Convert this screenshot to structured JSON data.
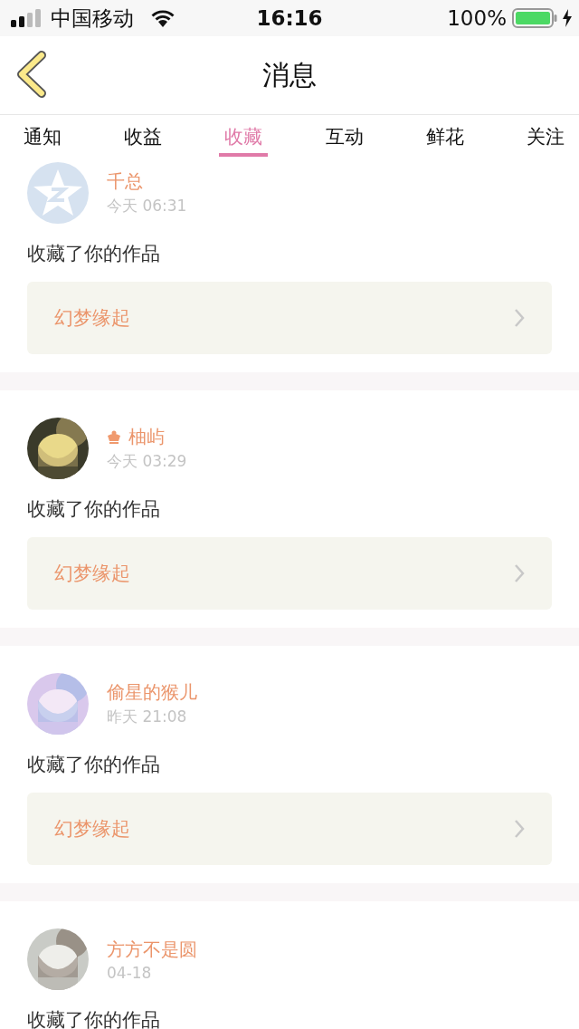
{
  "status_bar": {
    "carrier": "中国移动",
    "time": "16:16",
    "battery": "100%"
  },
  "nav": {
    "title": "消息"
  },
  "tabs": [
    {
      "label": "通知",
      "selected": false
    },
    {
      "label": "收益",
      "selected": false
    },
    {
      "label": "收藏",
      "selected": true
    },
    {
      "label": "互动",
      "selected": false
    },
    {
      "label": "鲜花",
      "selected": false
    },
    {
      "label": "关注",
      "selected": false
    }
  ],
  "messages": [
    {
      "avatar": {
        "kind": "default"
      },
      "name": "千总",
      "vip": false,
      "time": "今天 06:31",
      "text": "收藏了你的作品",
      "work": "幻梦缘起"
    },
    {
      "name": "柚屿",
      "vip": true,
      "time": "今天 03:29",
      "text": "收藏了你的作品",
      "work": "幻梦缘起"
    },
    {
      "name": "偷星的猴儿",
      "vip": false,
      "time": "昨天 21:08",
      "text": "收藏了你的作品",
      "work": "幻梦缘起"
    },
    {
      "name": "方方不是圆",
      "vip": false,
      "time": "04-18",
      "text": "收藏了你的作品"
    }
  ]
}
